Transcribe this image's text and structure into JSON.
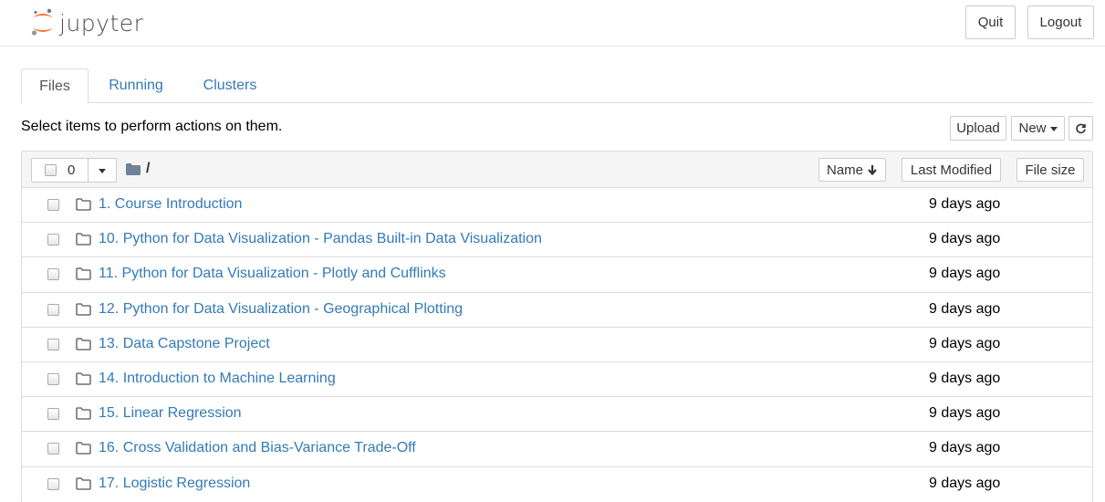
{
  "header": {
    "logo_text": "jupyter",
    "quit_label": "Quit",
    "logout_label": "Logout"
  },
  "tabs": [
    {
      "label": "Files",
      "active": true
    },
    {
      "label": "Running",
      "active": false
    },
    {
      "label": "Clusters",
      "active": false
    }
  ],
  "toolbar": {
    "hint": "Select items to perform actions on them.",
    "upload_label": "Upload",
    "new_label": "New",
    "refresh_icon": "refresh-icon"
  },
  "list_header": {
    "selected_count": "0",
    "breadcrumb": "/",
    "sort_name_label": "Name",
    "sort_modified_label": "Last Modified",
    "sort_size_label": "File size"
  },
  "files": [
    {
      "name": "1. Course Introduction",
      "modified": "9 days ago"
    },
    {
      "name": "10. Python for Data Visualization - Pandas Built-in Data Visualization",
      "modified": "9 days ago"
    },
    {
      "name": "11. Python for Data Visualization - Plotly and Cufflinks",
      "modified": "9 days ago"
    },
    {
      "name": "12. Python for Data Visualization - Geographical Plotting",
      "modified": "9 days ago"
    },
    {
      "name": "13. Data Capstone Project",
      "modified": "9 days ago"
    },
    {
      "name": "14. Introduction to Machine Learning",
      "modified": "9 days ago"
    },
    {
      "name": "15. Linear Regression",
      "modified": "9 days ago"
    },
    {
      "name": "16. Cross Validation and Bias-Variance Trade-Off",
      "modified": "9 days ago"
    },
    {
      "name": "17. Logistic Regression",
      "modified": "9 days ago"
    }
  ],
  "colors": {
    "link": "#337ab7",
    "jupyter_orange": "#f37726",
    "border": "#dddddd"
  }
}
